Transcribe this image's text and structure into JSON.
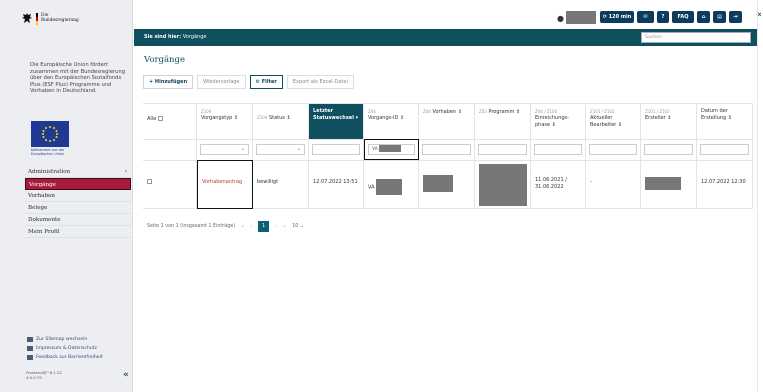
{
  "sidebar": {
    "logo_text": "Die\nBundesregierung",
    "eu_text": "Die Europäische Union fördert zusammen mit der Bundesregierung über den Europäischen Sozialfonds Plus (ESF Plus) Programme und Vorhaben in Deutschland.",
    "eu_caption": "Kofinanziert von der\nEuropäischen Union",
    "nav": [
      {
        "label": "Administration"
      },
      {
        "label": "Vorgänge"
      },
      {
        "label": "Vorhaben"
      },
      {
        "label": "Belege"
      },
      {
        "label": "Dokumente"
      },
      {
        "label": "Mein Profil"
      }
    ],
    "footer_links": [
      "Zur Sitemap wechseln",
      "Impressum & Datenschutz",
      "Feedback zur Barrierefreiheit"
    ],
    "version": "Frontend@^8.1.22\n4.0.0.79",
    "collapse_glyph": "«"
  },
  "topbar": {
    "session_label": "120 min",
    "faq_label": "FAQ",
    "help_label": "?",
    "collapse_glyph": "«"
  },
  "breadcrumb": {
    "prefix": "Sie sind hier:",
    "current": "Vorgänge",
    "search_placeholder": "Suchen"
  },
  "main": {
    "title": "Vorgänge",
    "toolbar": {
      "add": "+ Hinzufügen",
      "resubmit": "Wiedervorlage",
      "filter": "Filter",
      "export": "Export als Excel-Datei"
    },
    "columns": [
      {
        "sub": "",
        "label": "Alle"
      },
      {
        "sub": "Z104",
        "label": "Vorgangstyp ⇕"
      },
      {
        "sub": "Z104",
        "label": "Status ⇕"
      },
      {
        "sub": "",
        "label": "Letzter Statuswechsel ▾"
      },
      {
        "sub": "Z04",
        "label": "Vorgangs-ID ⇕"
      },
      {
        "sub": "Z04",
        "label": "Vorhaben ⇕"
      },
      {
        "sub": "Z03",
        "label": "Programm ⇕"
      },
      {
        "sub": "Z04 / Z100",
        "label": "Einreichungs-phase ⇕"
      },
      {
        "sub": "Z101 / Z102",
        "label": "Aktueller Bearbeiter ⇕"
      },
      {
        "sub": "Z101 / Z102",
        "label": "Ersteller ⇕"
      },
      {
        "sub": "",
        "label": "Datum der Erstellung ⇕"
      }
    ],
    "filter_id_value": "VA",
    "row": {
      "type": "Vorhabenantrag",
      "status": "bewilligt",
      "last_change": "12.07.2022 13:51",
      "id_prefix": "VA",
      "phase": "11.06.2021 / 31.06.2022",
      "editor": "-",
      "created": "12.07.2022 12:30"
    },
    "pager": {
      "info": "Seite 1 von 1 (insgesamt 1 Einträge)",
      "page": "1",
      "per_page": "10"
    }
  }
}
